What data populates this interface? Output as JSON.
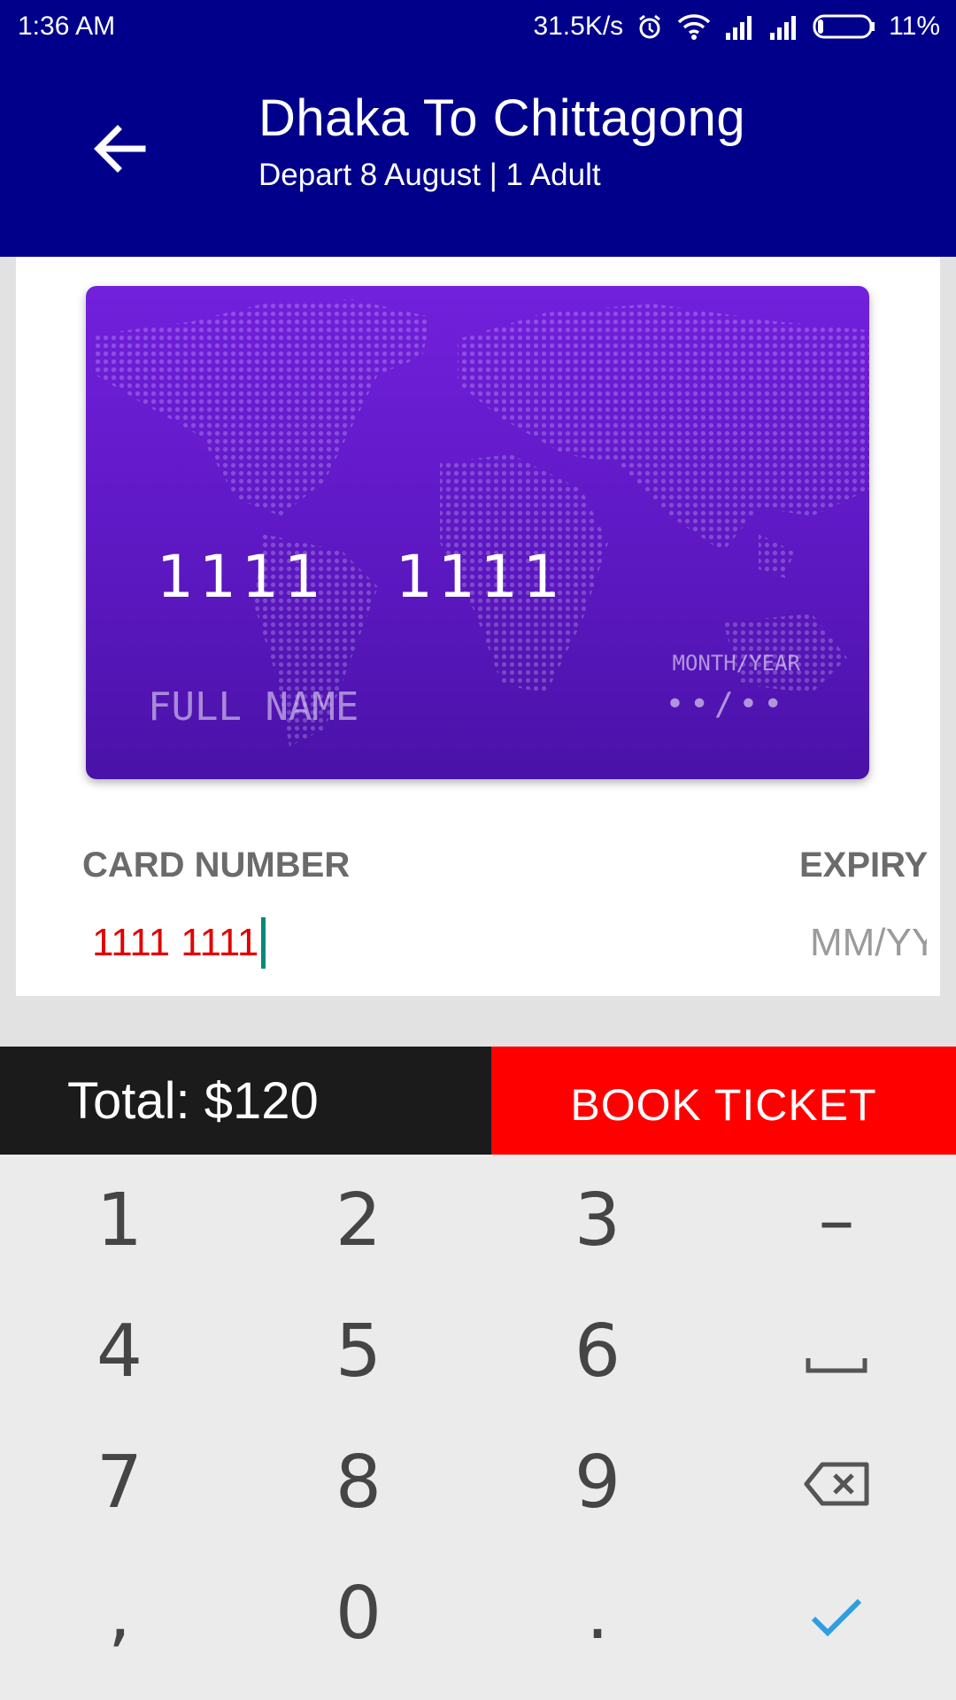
{
  "status_bar": {
    "time": "1:36 AM",
    "network_speed": "31.5K/s",
    "battery": "11%",
    "icons": [
      "alarm-icon",
      "wifi-icon",
      "signal-icon",
      "signal-icon",
      "battery-icon"
    ]
  },
  "app_bar": {
    "title": "Dhaka To Chittagong",
    "subtitle": "Depart 8 August | 1 Adult",
    "back_icon": "arrow-back-icon"
  },
  "card_preview": {
    "number": "1111  1111",
    "name_placeholder": "FULL NAME",
    "expiry_label": "MONTH/YEAR",
    "expiry_value": "••/••"
  },
  "form": {
    "card_number_label": "CARD NUMBER",
    "card_number_value": "1111 1111",
    "expiry_label": "EXPIRY",
    "expiry_placeholder": "MM/YY"
  },
  "footer": {
    "total": "Total: $120",
    "book_label": "BOOK TICKET"
  },
  "keyboard": {
    "keys": [
      {
        "label": "1",
        "name": "key-1"
      },
      {
        "label": "2",
        "name": "key-2"
      },
      {
        "label": "3",
        "name": "key-3"
      },
      {
        "label": "–",
        "name": "key-dash"
      },
      {
        "label": "4",
        "name": "key-4"
      },
      {
        "label": "5",
        "name": "key-5"
      },
      {
        "label": "6",
        "name": "key-6"
      },
      {
        "label": "",
        "name": "key-space",
        "icon": "space-icon"
      },
      {
        "label": "7",
        "name": "key-7"
      },
      {
        "label": "8",
        "name": "key-8"
      },
      {
        "label": "9",
        "name": "key-9"
      },
      {
        "label": "",
        "name": "key-backspace",
        "icon": "backspace-icon"
      },
      {
        "label": ",",
        "name": "key-comma"
      },
      {
        "label": "0",
        "name": "key-0"
      },
      {
        "label": ".",
        "name": "key-period"
      },
      {
        "label": "",
        "name": "key-done",
        "icon": "checkmark-icon"
      }
    ]
  },
  "colors": {
    "app_bar": "#00008b",
    "card": "#6a1bd3",
    "book_button": "#ff0000",
    "total_bar": "#1b1b1b",
    "input_text": "#e10000",
    "cursor": "#00897b",
    "done_key": "#2f9ee0"
  }
}
